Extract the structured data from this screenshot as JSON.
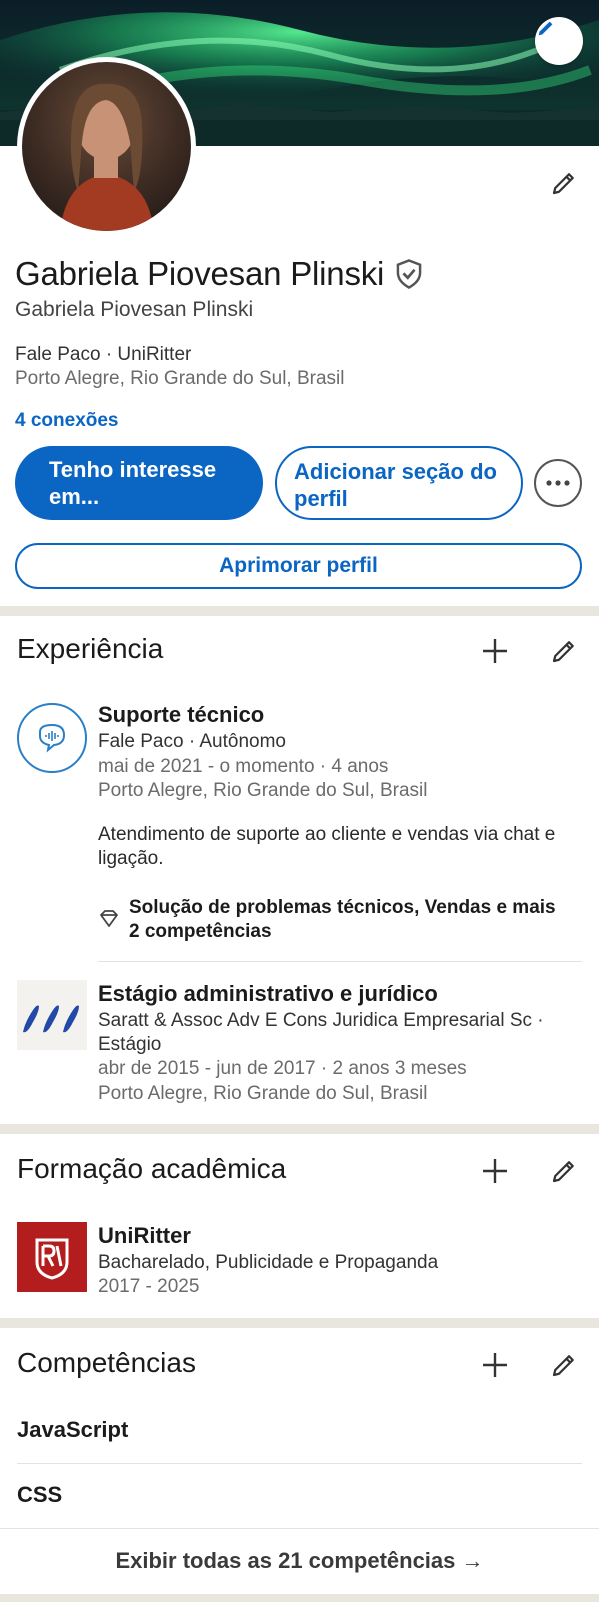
{
  "profile": {
    "name": "Gabriela Piovesan Plinski",
    "headline": "Gabriela Piovesan Plinski",
    "work": "Fale Paco · UniRitter",
    "location": "Porto Alegre, Rio Grande do Sul, Brasil",
    "connections": "4 conexões"
  },
  "actions": {
    "primary_label": "Tenho interesse em...",
    "add_section_label": "Adicionar seção do perfil",
    "improve_label": "Aprimorar perfil"
  },
  "experience": {
    "title": "Experiência",
    "items": [
      {
        "title": "Suporte técnico",
        "company": "Fale Paco · Autônomo",
        "dates": "mai de 2021 - o momento · 4 anos",
        "location": "Porto Alegre, Rio Grande do Sul, Brasil",
        "description": "Atendimento de suporte ao cliente e vendas via chat e ligação.",
        "skills": "Solução de problemas técnicos, Vendas e mais 2 competências"
      },
      {
        "title": "Estágio administrativo e jurídico",
        "company": "Saratt & Assoc Adv E Cons Juridica Empresarial Sc · Estágio",
        "dates": "abr de 2015 - jun de 2017 · 2 anos 3 meses",
        "location": "Porto Alegre, Rio Grande do Sul, Brasil"
      }
    ]
  },
  "education": {
    "title": "Formação acadêmica",
    "items": [
      {
        "school": "UniRitter",
        "degree": "Bacharelado, Publicidade e Propaganda",
        "dates": "2017 - 2025"
      }
    ]
  },
  "skills": {
    "title": "Competências",
    "items": [
      "JavaScript",
      "CSS"
    ],
    "show_all": "Exibir todas as 21 competências →"
  },
  "colors": {
    "accent": "#0a66c2",
    "separator": "#e9e5df",
    "uniritter_red": "#b31d1d"
  },
  "icons": {
    "cover_edit": "pencil-icon",
    "profile_edit": "pencil-icon",
    "verified": "shield-check-icon",
    "more": "ellipsis-icon",
    "add": "plus-icon",
    "skills": "diamond-icon"
  }
}
